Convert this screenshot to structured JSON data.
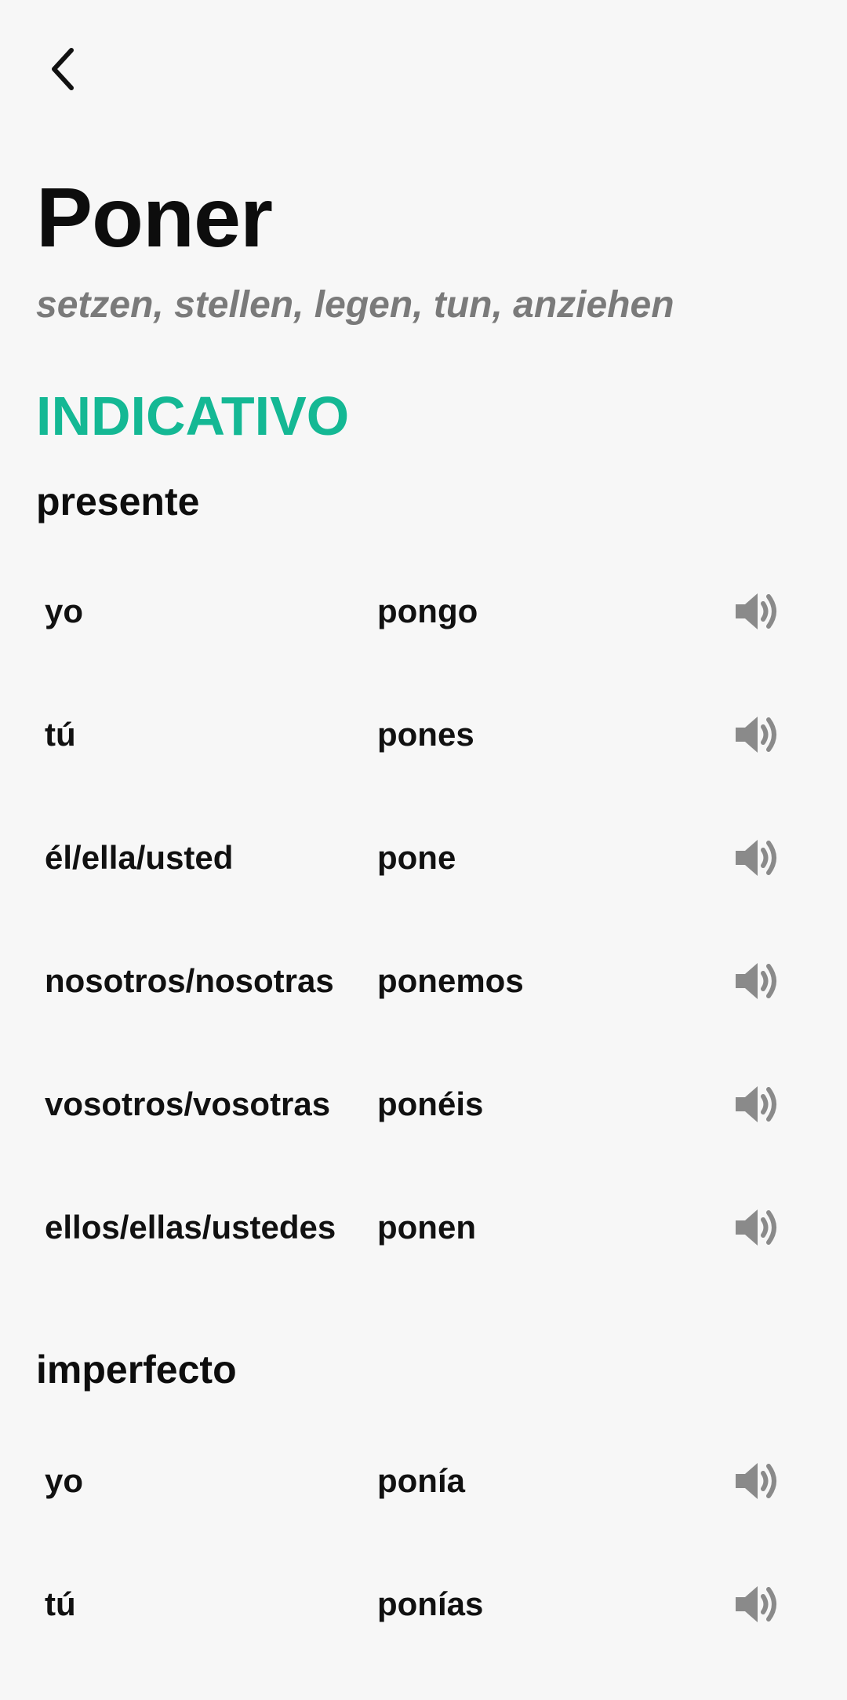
{
  "header": {
    "verb": "Poner",
    "translations": "setzen, stellen, legen, tun, anziehen"
  },
  "icons": {
    "back": "chevron-left-icon",
    "audio": "speaker-icon"
  },
  "colors": {
    "accent": "#14b894",
    "background": "#f7f7f7",
    "muted": "#7a7a7a",
    "icon": "#8a8a8a"
  },
  "mood": {
    "label": "INDICATIVO"
  },
  "tenses": [
    {
      "label": "presente",
      "rows": [
        {
          "pronoun": "yo",
          "form": "pongo"
        },
        {
          "pronoun": "tú",
          "form": "pones"
        },
        {
          "pronoun": "él/ella/usted",
          "form": "pone"
        },
        {
          "pronoun": "nosotros/nosotras",
          "form": "ponemos"
        },
        {
          "pronoun": "vosotros/vosotras",
          "form": "ponéis"
        },
        {
          "pronoun": "ellos/ellas/ustedes",
          "form": "ponen"
        }
      ]
    },
    {
      "label": "imperfecto",
      "rows": [
        {
          "pronoun": "yo",
          "form": "ponía"
        },
        {
          "pronoun": "tú",
          "form": "ponías"
        }
      ]
    }
  ]
}
